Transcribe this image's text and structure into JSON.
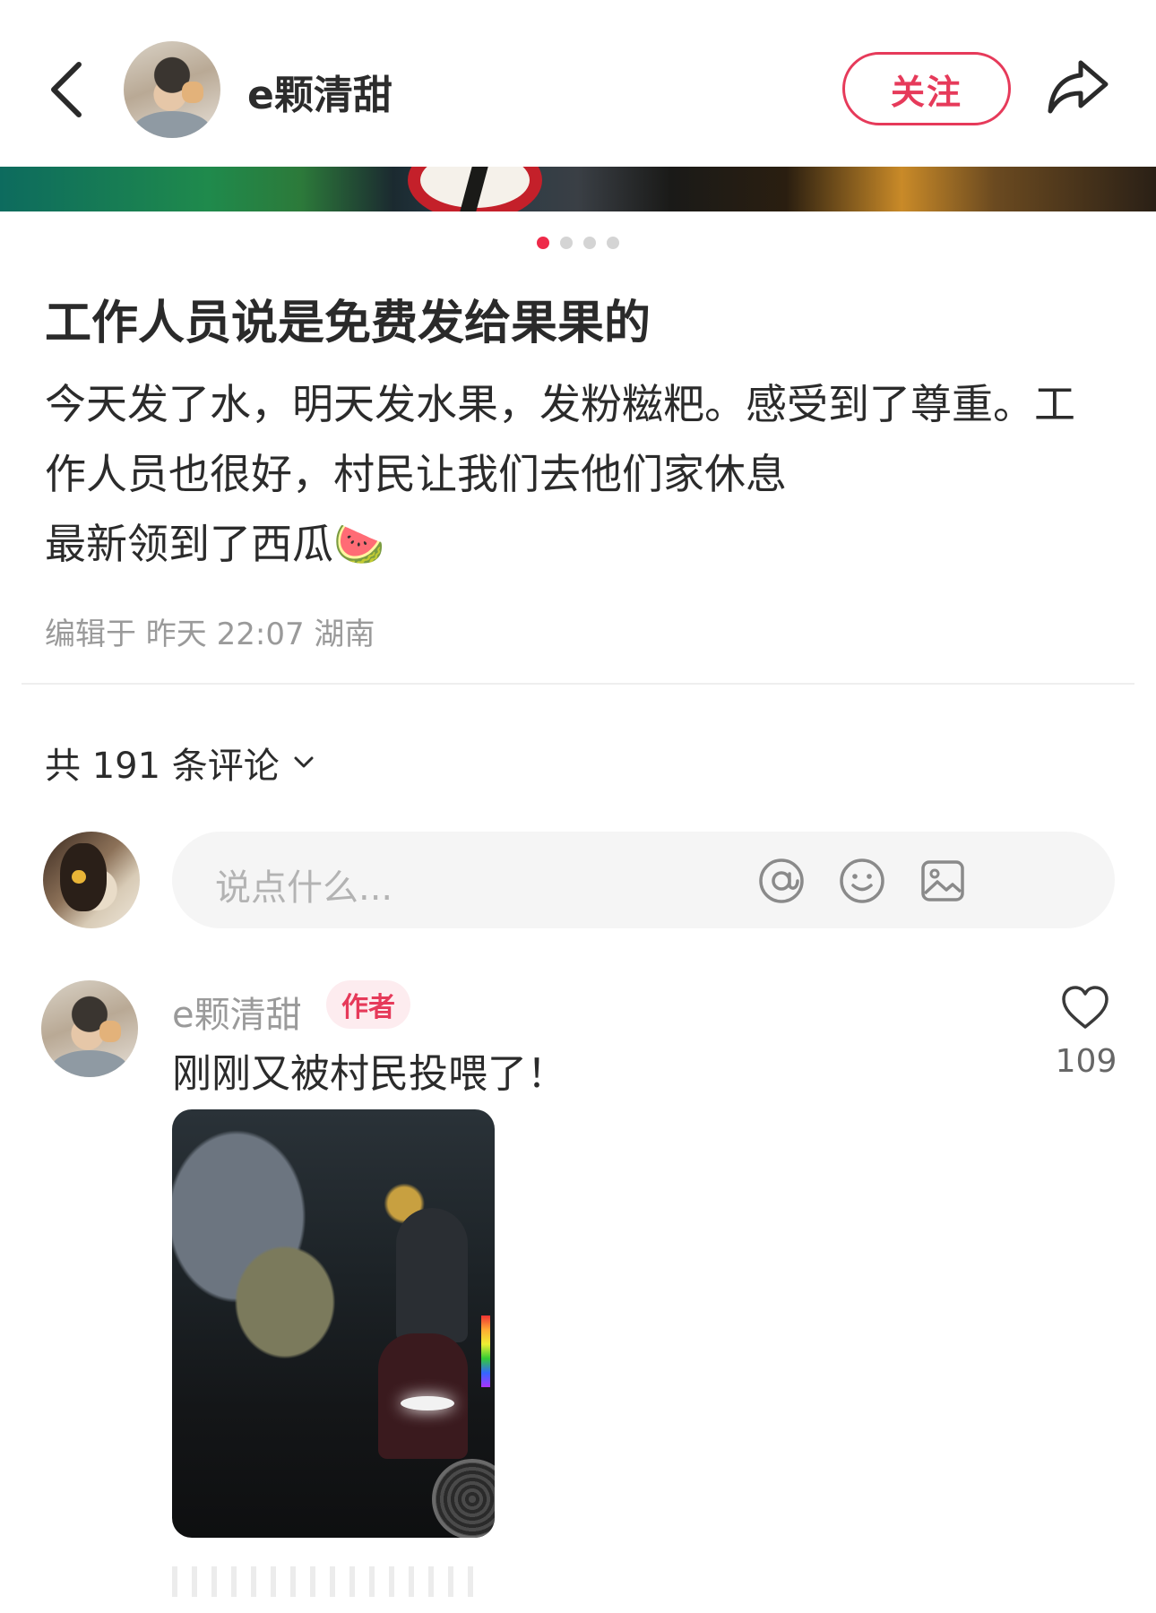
{
  "header": {
    "author_name": "e颗清甜",
    "follow_label": "关注"
  },
  "gallery": {
    "page_count": 4,
    "active_page": 1
  },
  "post": {
    "title": "工作人员说是免费发给果果的",
    "body_lines": [
      "今天发了水，明天发水果，发粉糍粑。感受到了尊重。工",
      "作人员也很好，村民让我们去他们家休息",
      "最新领到了西瓜🍉"
    ],
    "meta": "编辑于 昨天 22:07 湖南"
  },
  "comments_section": {
    "count_label": "共 191 条评论",
    "input_placeholder": "说点什么..."
  },
  "comments": [
    {
      "user": "e颗清甜",
      "badge": "作者",
      "text": "刚刚又被村民投喂了！",
      "likes": "109"
    }
  ],
  "icons": {
    "back": "chevron-left-icon",
    "share": "share-arrow-icon",
    "mention": "at-sign-icon",
    "emoji": "smiley-icon",
    "image": "image-icon",
    "like": "heart-outline-icon",
    "expand": "chevron-down-icon"
  },
  "colors": {
    "accent": "#e63a5a",
    "dot_active": "#ee2a49",
    "dot_inactive": "#d4d4d4",
    "muted_text": "#9a9a9a",
    "input_bg": "#f5f5f5"
  }
}
